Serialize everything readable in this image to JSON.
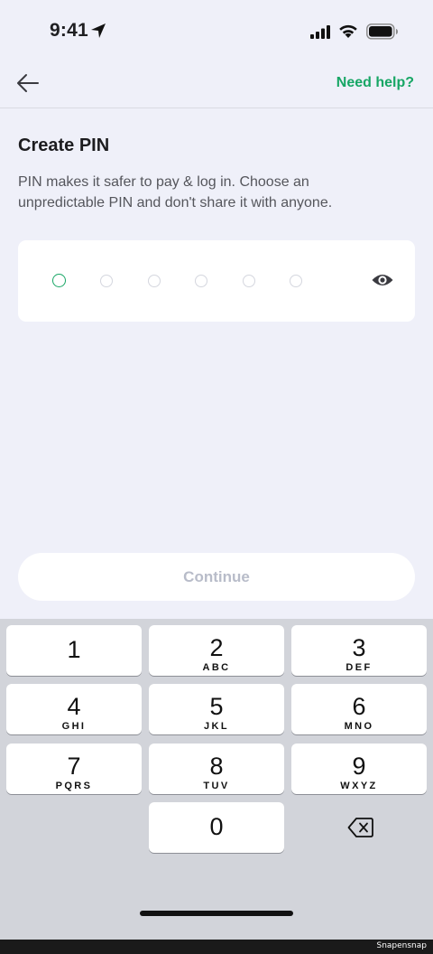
{
  "status_bar": {
    "time": "9:41"
  },
  "header": {
    "help_label": "Need help?"
  },
  "page": {
    "title": "Create PIN",
    "description": "PIN makes it safer to pay & log in. Choose an unpredictable PIN and don't share it with anyone."
  },
  "pin": {
    "length": 6,
    "entered": 0,
    "active_index": 0
  },
  "continue_label": "Continue",
  "colors": {
    "accent": "#17a665",
    "background": "#eff0f9",
    "keyboard": "#d2d4da",
    "disabled_text": "#b8bcc9"
  },
  "keypad": {
    "k1": {
      "digit": "1",
      "letters": ""
    },
    "k2": {
      "digit": "2",
      "letters": "ABC"
    },
    "k3": {
      "digit": "3",
      "letters": "DEF"
    },
    "k4": {
      "digit": "4",
      "letters": "GHI"
    },
    "k5": {
      "digit": "5",
      "letters": "JKL"
    },
    "k6": {
      "digit": "6",
      "letters": "MNO"
    },
    "k7": {
      "digit": "7",
      "letters": "PQRS"
    },
    "k8": {
      "digit": "8",
      "letters": "TUV"
    },
    "k9": {
      "digit": "9",
      "letters": "WXYZ"
    },
    "k0": {
      "digit": "0",
      "letters": ""
    }
  },
  "icons": [
    "location-arrow-icon",
    "signal-icon",
    "wifi-icon",
    "battery-icon",
    "back-arrow-icon",
    "eye-icon",
    "delete-icon"
  ],
  "watermark": "Snapensnap"
}
